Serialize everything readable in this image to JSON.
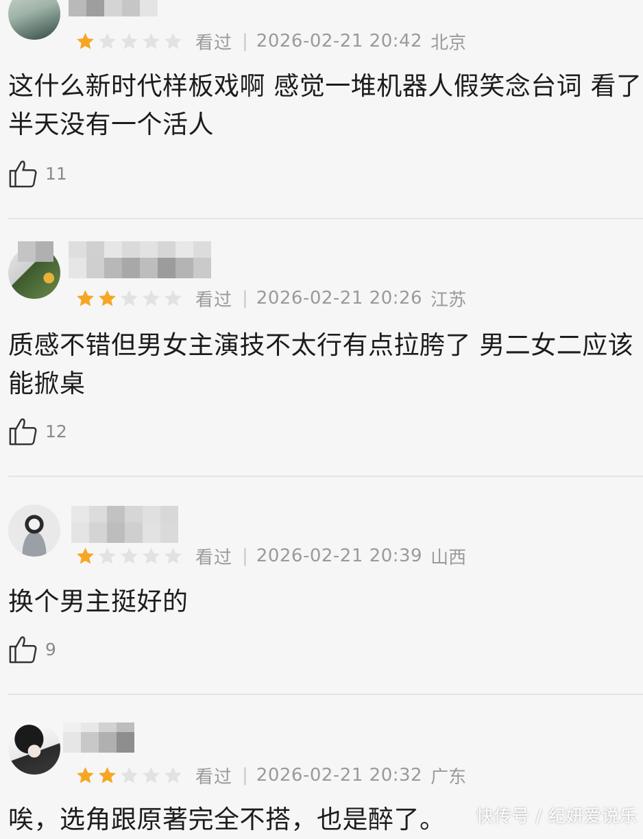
{
  "reviews": [
    {
      "rating": 1,
      "status": "看过",
      "time": "2026-02-21 20:42",
      "location": "北京",
      "content_lines": [
        "这什么新时代样板戏啊 感觉一堆机器人假笑念台词 看了",
        "半天没有一个活人"
      ],
      "likes": "11"
    },
    {
      "rating": 2,
      "status": "看过",
      "time": "2026-02-21 20:26",
      "location": "江苏",
      "content_lines": [
        "质感不错但男女主演技不太行有点拉胯了 男二女二应该",
        "能掀桌"
      ],
      "likes": "12"
    },
    {
      "rating": 1,
      "status": "看过",
      "time": "2026-02-21 20:39",
      "location": "山西",
      "content_lines": [
        "换个男主挺好的"
      ],
      "likes": "9"
    },
    {
      "rating": 2,
      "status": "看过",
      "time": "2026-02-21 20:32",
      "location": "广东",
      "content_lines": [
        "唉，选角跟原著完全不搭，也是醉了。"
      ],
      "likes": ""
    }
  ],
  "colors": {
    "star_filled": "#f5a623",
    "star_empty": "#e2e2e2",
    "meta_text": "#9a9a9a",
    "background": "#f6f6f6"
  },
  "icons": {
    "like": "thumbs-up-icon",
    "star": "star-icon"
  },
  "watermark": "快传号 / 纪妍爱说乐"
}
